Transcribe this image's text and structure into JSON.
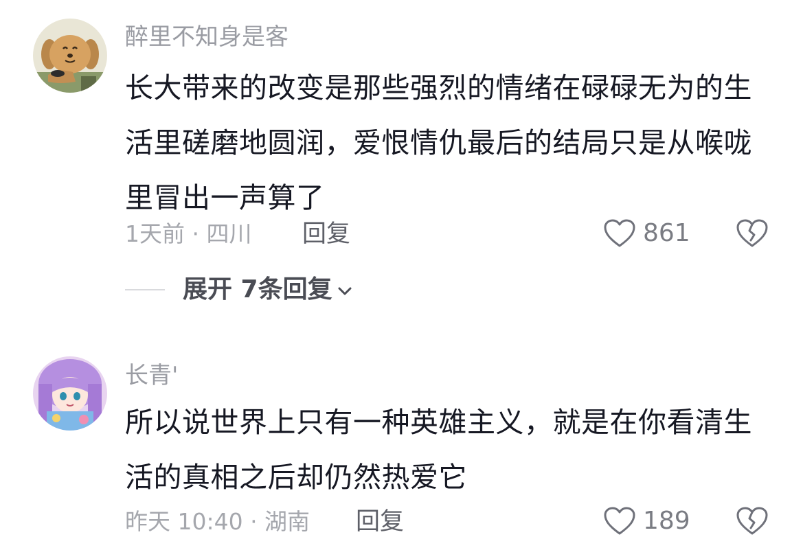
{
  "comments": [
    {
      "username": "醉里不知身是客",
      "avatar_icon": "cartoon-dog-avatar",
      "content": "长大带来的改变是那些强烈的情绪在碌碌无为的生活里磋磨地圆润，爱恨情仇最后的结局只是从喉咙里冒出一声算了",
      "time_location": "1天前 · 四川",
      "reply_label": "回复",
      "like_count": "861",
      "like_icon": "heart-icon",
      "dislike_icon": "broken-heart-icon",
      "expand_replies_label": "展开 7条回复"
    },
    {
      "username": "长青'",
      "avatar_icon": "anime-girl-avatar",
      "content": "所以说世界上只有一种英雄主义，就是在你看清生活的真相之后却仍然热爱它",
      "time_location": "昨天 10:40 · 湖南",
      "reply_label": "回复",
      "like_count": "189",
      "like_icon": "heart-icon",
      "dislike_icon": "broken-heart-icon"
    }
  ],
  "colors": {
    "text_primary": "#161823",
    "text_secondary": "#9a9ca3",
    "icon_gray": "#6f717a"
  }
}
